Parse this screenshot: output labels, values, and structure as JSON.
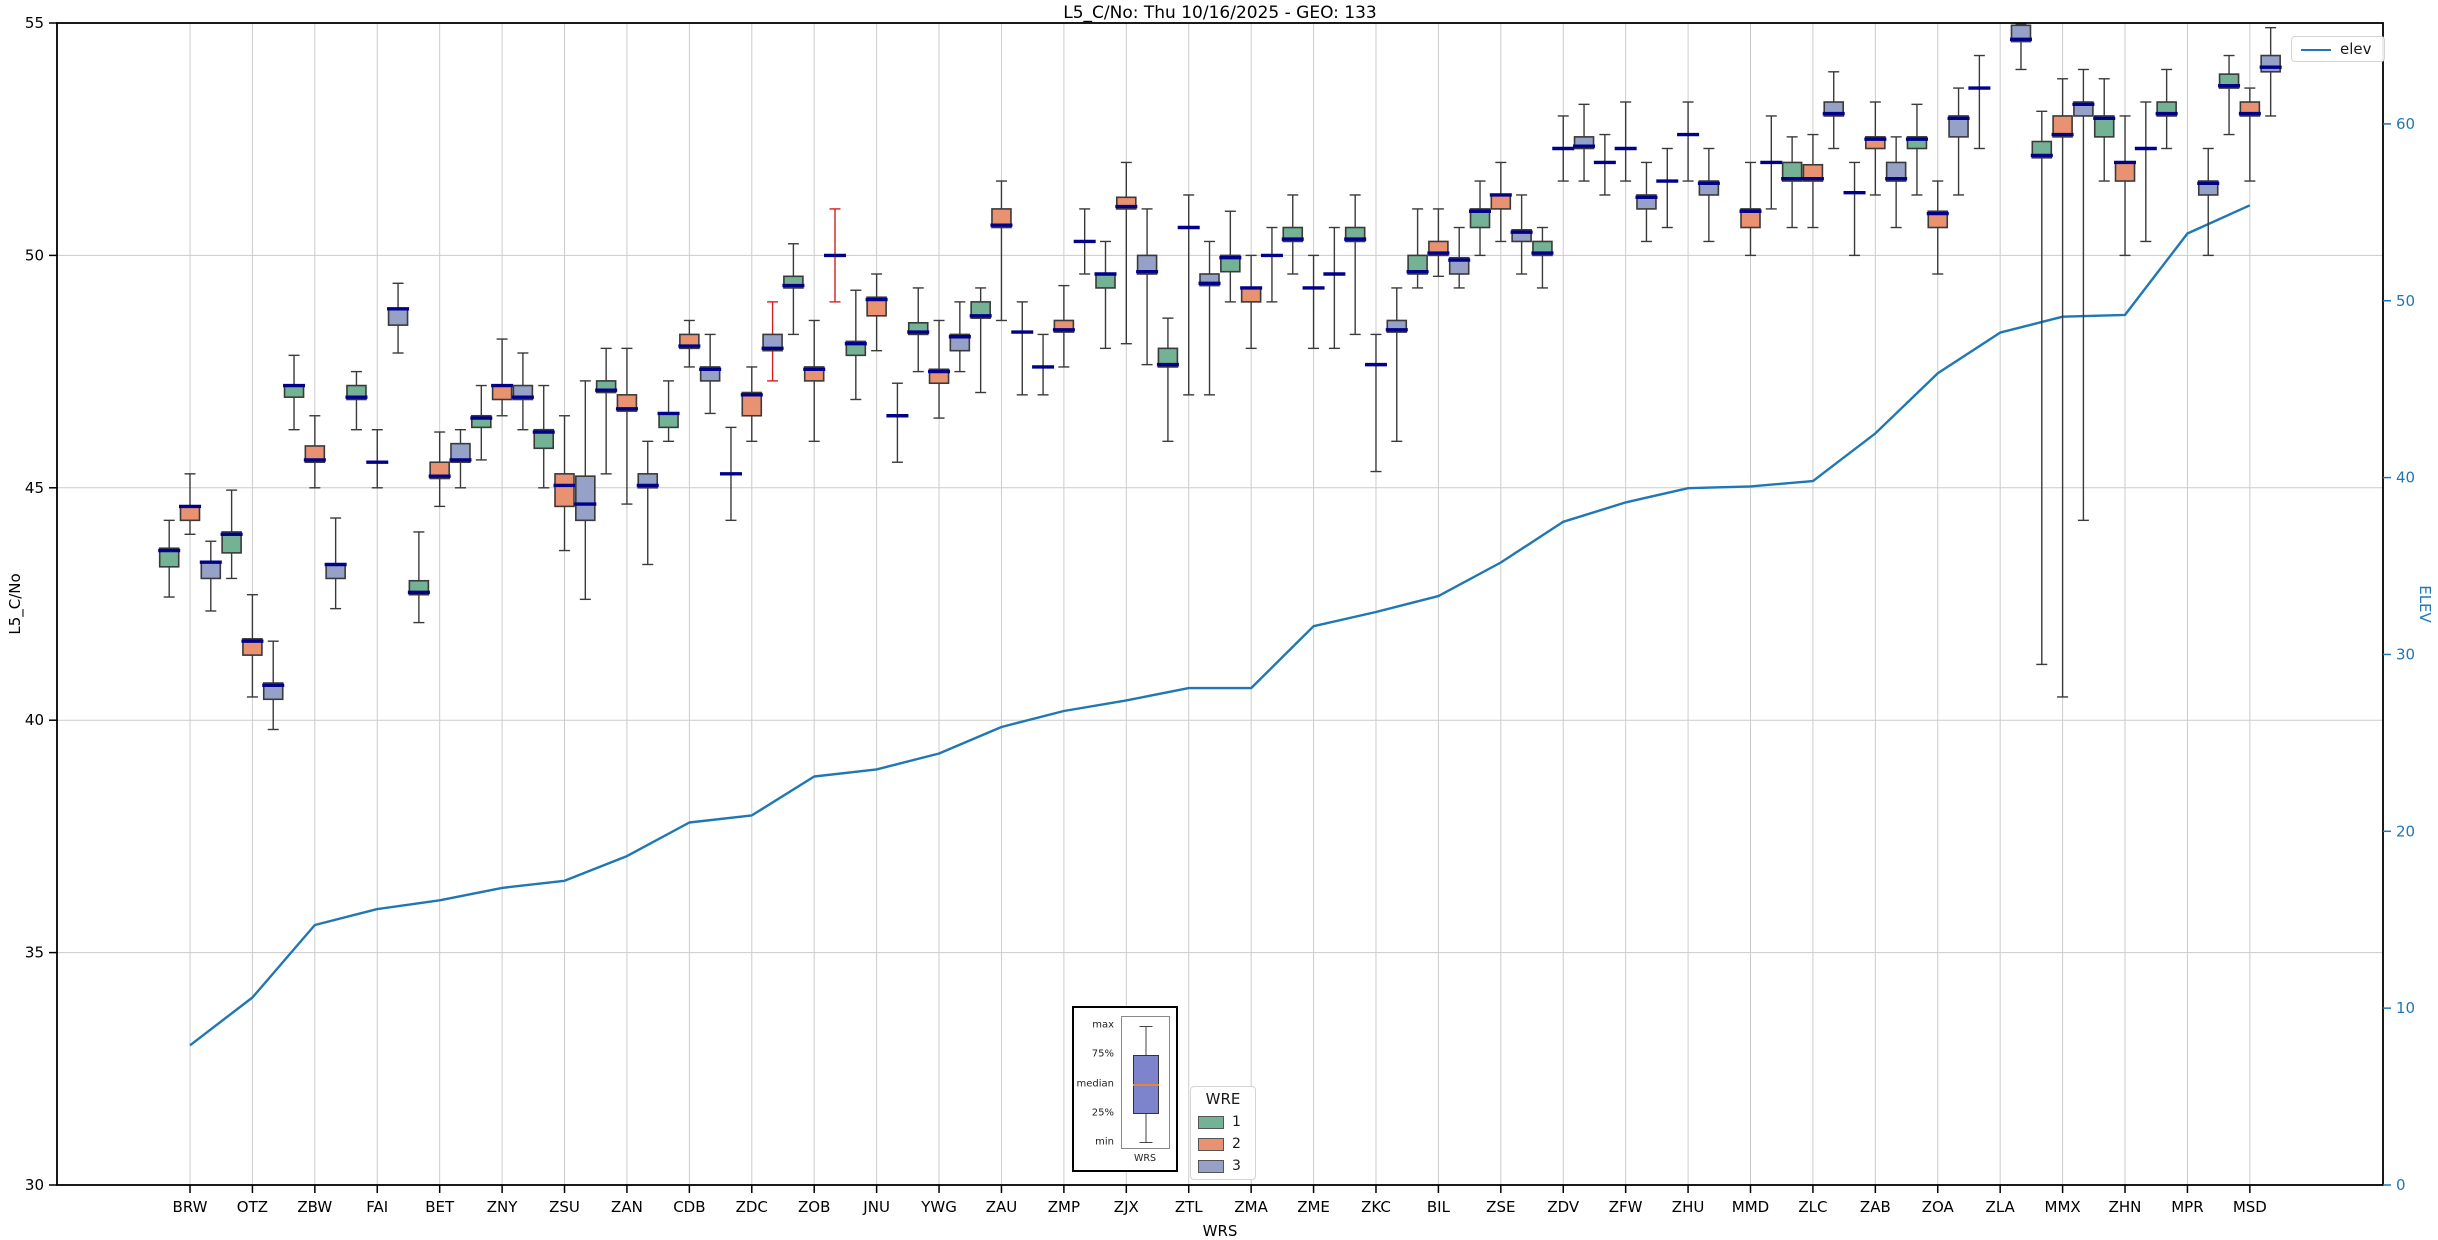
{
  "title": "L5_C/No: Thu 10/16/2025 - GEO: 133",
  "axes": {
    "left_label": "L5_C/No",
    "bottom_label": "WRS",
    "right_label": "ELEV",
    "left_ticks": [
      30,
      35,
      40,
      45,
      50,
      55
    ],
    "right_ticks": [
      0,
      10,
      20,
      30,
      40,
      50,
      60
    ],
    "left_range": [
      30,
      55
    ],
    "grid_values": [
      35,
      40,
      45,
      50
    ]
  },
  "legend_elev": {
    "label": "elev"
  },
  "legend_wre": {
    "title": "WRE",
    "entries": [
      {
        "label": "1",
        "color": "#73b294"
      },
      {
        "label": "2",
        "color": "#e99272"
      },
      {
        "label": "3",
        "color": "#95a1c7"
      }
    ]
  },
  "inset": {
    "rows": [
      {
        "label": "max"
      },
      {
        "label": "75%"
      },
      {
        "label": "median"
      },
      {
        "label": "25%"
      },
      {
        "label": "min"
      }
    ],
    "xlabel": "WRS"
  },
  "colors": {
    "box_fill": [
      "#73b294",
      "#e99272",
      "#95a1c7"
    ],
    "box_edge": "#3a3a3a",
    "median": "#00008b",
    "whisker": "#3a3a3a",
    "whisker_flagged": "#d62020",
    "elev_line": "#1f77b4",
    "grid": "#cccccc",
    "right_axis": "#1f77b4"
  },
  "chart_data": {
    "type": "box+line",
    "title": "L5_C/No: Thu 10/16/2025 - GEO: 133",
    "xlabel": "WRS",
    "ylabel_left": "L5_C/No",
    "ylabel_right": "ELEV",
    "ylim_left": [
      30,
      55
    ],
    "right_tick_range": [
      0,
      60
    ],
    "hue_title": "WRE",
    "hue_levels": [
      "1",
      "2",
      "3"
    ],
    "line_series_name": "elev",
    "categories": [
      "BRW",
      "OTZ",
      "ZBW",
      "FAI",
      "BET",
      "ZNY",
      "ZSU",
      "ZAN",
      "CDB",
      "ZDC",
      "ZOB",
      "JNU",
      "YWG",
      "ZAU",
      "ZMP",
      "ZJX",
      "ZTL",
      "ZMA",
      "ZME",
      "ZKC",
      "BIL",
      "ZSE",
      "ZDV",
      "ZFW",
      "ZHU",
      "MMD",
      "ZLC",
      "ZAB",
      "ZOA",
      "ZLA",
      "MMX",
      "ZHN",
      "MPR",
      "MSD"
    ],
    "stations": [
      {
        "name": "BRW",
        "elev": 7.9,
        "w1": {
          "lo": 42.65,
          "q1": 43.3,
          "med": 43.65,
          "q3": 43.7,
          "hi": 44.3
        },
        "w2": {
          "lo": 44.0,
          "q1": 44.3,
          "med": 44.6,
          "q3": 44.6,
          "hi": 45.3
        },
        "w3": {
          "lo": 42.35,
          "q1": 43.05,
          "med": 43.4,
          "q3": 43.4,
          "hi": 43.85
        }
      },
      {
        "name": "OTZ",
        "elev": 10.6,
        "w1": {
          "lo": 43.05,
          "q1": 43.6,
          "med": 44.0,
          "q3": 44.05,
          "hi": 44.95
        },
        "w2": {
          "lo": 40.5,
          "q1": 41.4,
          "med": 41.7,
          "q3": 41.75,
          "hi": 42.7
        },
        "w3": {
          "lo": 39.8,
          "q1": 40.45,
          "med": 40.75,
          "q3": 40.8,
          "hi": 41.7
        }
      },
      {
        "name": "ZBW",
        "elev": 14.7,
        "w1": {
          "lo": 46.25,
          "q1": 46.95,
          "med": 47.2,
          "q3": 47.2,
          "hi": 47.85
        },
        "w2": {
          "lo": 45.0,
          "q1": 45.55,
          "med": 45.6,
          "q3": 45.9,
          "hi": 46.55
        },
        "w3": {
          "lo": 42.4,
          "q1": 43.05,
          "med": 43.35,
          "q3": 43.35,
          "hi": 44.35
        }
      },
      {
        "name": "FAI",
        "elev": 15.6,
        "w1": {
          "lo": 46.25,
          "q1": 46.9,
          "med": 46.95,
          "q3": 47.2,
          "hi": 47.5
        },
        "w2": {
          "lo": 45.0,
          "q1": 45.55,
          "med": 45.55,
          "q3": 45.55,
          "hi": 46.25,
          "flat": true
        },
        "w3": {
          "lo": 47.9,
          "q1": 48.5,
          "med": 48.85,
          "q3": 48.85,
          "hi": 49.4
        }
      },
      {
        "name": "BET",
        "elev": 16.1,
        "w1": {
          "lo": 42.1,
          "q1": 42.7,
          "med": 42.75,
          "q3": 43.0,
          "hi": 44.05
        },
        "w2": {
          "lo": 44.6,
          "q1": 45.2,
          "med": 45.25,
          "q3": 45.55,
          "hi": 46.2
        },
        "w3": {
          "lo": 45.0,
          "q1": 45.55,
          "med": 45.6,
          "q3": 45.95,
          "hi": 46.25
        }
      },
      {
        "name": "ZNY",
        "elev": 16.8,
        "w1": {
          "lo": 45.6,
          "q1": 46.3,
          "med": 46.5,
          "q3": 46.55,
          "hi": 47.2
        },
        "w2": {
          "lo": 46.55,
          "q1": 46.9,
          "med": 47.2,
          "q3": 47.2,
          "hi": 48.2
        },
        "w3": {
          "lo": 46.25,
          "q1": 46.9,
          "med": 46.95,
          "q3": 47.2,
          "hi": 47.9
        }
      },
      {
        "name": "ZSU",
        "elev": 17.2,
        "w1": {
          "lo": 45.0,
          "q1": 45.85,
          "med": 46.2,
          "q3": 46.25,
          "hi": 47.2
        },
        "w2": {
          "lo": 43.65,
          "q1": 44.6,
          "med": 45.05,
          "q3": 45.3,
          "hi": 46.55
        },
        "w3": {
          "lo": 42.6,
          "q1": 44.3,
          "med": 44.65,
          "q3": 45.25,
          "hi": 47.3
        }
      },
      {
        "name": "ZAN",
        "elev": 18.6,
        "w1": {
          "lo": 45.3,
          "q1": 47.05,
          "med": 47.1,
          "q3": 47.3,
          "hi": 48.0
        },
        "w2": {
          "lo": 44.65,
          "q1": 46.65,
          "med": 46.7,
          "q3": 47.0,
          "hi": 48.0
        },
        "w3": {
          "lo": 43.35,
          "q1": 45.0,
          "med": 45.05,
          "q3": 45.3,
          "hi": 46.0
        }
      },
      {
        "name": "CDB",
        "elev": 20.5,
        "w1": {
          "lo": 46.0,
          "q1": 46.3,
          "med": 46.6,
          "q3": 46.6,
          "hi": 47.3
        },
        "w2": {
          "lo": 47.6,
          "q1": 48.0,
          "med": 48.05,
          "q3": 48.3,
          "hi": 48.6
        },
        "w3": {
          "lo": 46.6,
          "q1": 47.3,
          "med": 47.55,
          "q3": 47.6,
          "hi": 48.3
        }
      },
      {
        "name": "ZDC",
        "elev": 20.9,
        "w1": {
          "lo": 44.3,
          "q1": 45.3,
          "med": 45.3,
          "q3": 45.3,
          "hi": 46.3,
          "flat": true
        },
        "w2": {
          "lo": 46.0,
          "q1": 46.55,
          "med": 47.0,
          "q3": 47.05,
          "hi": 47.6
        },
        "w3": {
          "lo": 47.3,
          "q1": 47.95,
          "med": 48.0,
          "q3": 48.3,
          "hi": 49.0,
          "red": true
        }
      },
      {
        "name": "ZOB",
        "elev": 23.1,
        "w1": {
          "lo": 48.3,
          "q1": 49.3,
          "med": 49.35,
          "q3": 49.55,
          "hi": 50.25
        },
        "w2": {
          "lo": 46.0,
          "q1": 47.3,
          "med": 47.55,
          "q3": 47.6,
          "hi": 48.6
        },
        "w3": {
          "lo": 49.0,
          "q1": 50.0,
          "med": 50.0,
          "q3": 50.0,
          "hi": 51.0,
          "flat": true,
          "red": true
        }
      },
      {
        "name": "JNU",
        "elev": 23.5,
        "w1": {
          "lo": 46.9,
          "q1": 47.85,
          "med": 48.1,
          "q3": 48.15,
          "hi": 49.25
        },
        "w2": {
          "lo": 47.95,
          "q1": 48.7,
          "med": 49.05,
          "q3": 49.1,
          "hi": 49.6
        },
        "w3": {
          "lo": 45.55,
          "q1": 46.55,
          "med": 46.55,
          "q3": 46.55,
          "hi": 47.25,
          "flat": true
        }
      },
      {
        "name": "YWG",
        "elev": 24.4,
        "w1": {
          "lo": 47.5,
          "q1": 48.3,
          "med": 48.35,
          "q3": 48.55,
          "hi": 49.3
        },
        "w2": {
          "lo": 46.5,
          "q1": 47.25,
          "med": 47.5,
          "q3": 47.55,
          "hi": 48.6
        },
        "w3": {
          "lo": 47.5,
          "q1": 47.95,
          "med": 48.25,
          "q3": 48.3,
          "hi": 49.0
        }
      },
      {
        "name": "ZAU",
        "elev": 25.9,
        "w1": {
          "lo": 47.05,
          "q1": 48.65,
          "med": 48.7,
          "q3": 49.0,
          "hi": 49.3
        },
        "w2": {
          "lo": 48.6,
          "q1": 50.6,
          "med": 50.65,
          "q3": 51.0,
          "hi": 51.6
        },
        "w3": {
          "lo": 47.0,
          "q1": 48.35,
          "med": 48.35,
          "q3": 48.35,
          "hi": 49.0,
          "flat": true
        }
      },
      {
        "name": "ZMP",
        "elev": 26.8,
        "w1": {
          "lo": 47.0,
          "q1": 47.6,
          "med": 47.6,
          "q3": 47.6,
          "hi": 48.3,
          "flat": true
        },
        "w2": {
          "lo": 47.6,
          "q1": 48.35,
          "med": 48.4,
          "q3": 48.6,
          "hi": 49.35
        },
        "w3": {
          "lo": 49.6,
          "q1": 50.3,
          "med": 50.3,
          "q3": 50.3,
          "hi": 51.0,
          "flat": true
        }
      },
      {
        "name": "ZJX",
        "elev": 27.4,
        "w1": {
          "lo": 48.0,
          "q1": 49.3,
          "med": 49.6,
          "q3": 49.6,
          "hi": 50.3
        },
        "w2": {
          "lo": 48.1,
          "q1": 51.0,
          "med": 51.05,
          "q3": 51.25,
          "hi": 52.0
        },
        "w3": {
          "lo": 47.65,
          "q1": 49.6,
          "med": 49.65,
          "q3": 50.0,
          "hi": 51.0
        }
      },
      {
        "name": "ZTL",
        "elev": 28.1,
        "w1": {
          "lo": 46.0,
          "q1": 47.6,
          "med": 47.65,
          "q3": 48.0,
          "hi": 48.65
        },
        "w2": {
          "lo": 47.0,
          "q1": 50.6,
          "med": 50.6,
          "q3": 50.6,
          "hi": 51.3,
          "flat": true
        },
        "w3": {
          "lo": 47.0,
          "q1": 49.35,
          "med": 49.4,
          "q3": 49.6,
          "hi": 50.3
        }
      },
      {
        "name": "ZMA",
        "elev": 28.1,
        "w1": {
          "lo": 49.0,
          "q1": 49.65,
          "med": 49.95,
          "q3": 50.0,
          "hi": 50.95
        },
        "w2": {
          "lo": 48.0,
          "q1": 49.0,
          "med": 49.3,
          "q3": 49.3,
          "hi": 50.0
        },
        "w3": {
          "lo": 49.0,
          "q1": 50.0,
          "med": 50.0,
          "q3": 50.0,
          "hi": 50.6,
          "flat": true
        }
      },
      {
        "name": "ZME",
        "elev": 31.6,
        "w1": {
          "lo": 49.6,
          "q1": 50.3,
          "med": 50.35,
          "q3": 50.6,
          "hi": 51.3
        },
        "w2": {
          "lo": 48.0,
          "q1": 49.3,
          "med": 49.3,
          "q3": 49.3,
          "hi": 50.0,
          "flat": true
        },
        "w3": {
          "lo": 48.0,
          "q1": 49.6,
          "med": 49.6,
          "q3": 49.6,
          "hi": 50.6,
          "flat": true
        }
      },
      {
        "name": "ZKC",
        "elev": 32.4,
        "w1": {
          "lo": 48.3,
          "q1": 50.3,
          "med": 50.35,
          "q3": 50.6,
          "hi": 51.3
        },
        "w2": {
          "lo": 45.35,
          "q1": 47.65,
          "med": 47.65,
          "q3": 47.65,
          "hi": 48.3,
          "flat": true
        },
        "w3": {
          "lo": 46.0,
          "q1": 48.35,
          "med": 48.4,
          "q3": 48.6,
          "hi": 49.3
        }
      },
      {
        "name": "BIL",
        "elev": 33.3,
        "w1": {
          "lo": 49.3,
          "q1": 49.6,
          "med": 49.65,
          "q3": 50.0,
          "hi": 51.0
        },
        "w2": {
          "lo": 49.55,
          "q1": 50.0,
          "med": 50.05,
          "q3": 50.3,
          "hi": 51.0
        },
        "w3": {
          "lo": 49.3,
          "q1": 49.6,
          "med": 49.9,
          "q3": 49.95,
          "hi": 50.6
        }
      },
      {
        "name": "ZSE",
        "elev": 35.2,
        "w1": {
          "lo": 50.0,
          "q1": 50.6,
          "med": 50.95,
          "q3": 51.0,
          "hi": 51.6
        },
        "w2": {
          "lo": 50.3,
          "q1": 51.0,
          "med": 51.3,
          "q3": 51.3,
          "hi": 52.0
        },
        "w3": {
          "lo": 49.6,
          "q1": 50.3,
          "med": 50.5,
          "q3": 50.55,
          "hi": 51.3
        }
      },
      {
        "name": "ZDV",
        "elev": 37.5,
        "w1": {
          "lo": 49.3,
          "q1": 50.0,
          "med": 50.05,
          "q3": 50.3,
          "hi": 50.6
        },
        "w2": {
          "lo": 51.6,
          "q1": 52.3,
          "med": 52.3,
          "q3": 52.3,
          "hi": 53.0,
          "flat": true
        },
        "w3": {
          "lo": 51.6,
          "q1": 52.3,
          "med": 52.35,
          "q3": 52.55,
          "hi": 53.25
        }
      },
      {
        "name": "ZFW",
        "elev": 38.6,
        "w1": {
          "lo": 51.3,
          "q1": 52.0,
          "med": 52.0,
          "q3": 52.0,
          "hi": 52.6,
          "flat": true
        },
        "w2": {
          "lo": 51.6,
          "q1": 52.3,
          "med": 52.3,
          "q3": 52.3,
          "hi": 53.3,
          "flat": true
        },
        "w3": {
          "lo": 50.3,
          "q1": 51.0,
          "med": 51.25,
          "q3": 51.3,
          "hi": 52.0
        }
      },
      {
        "name": "ZHU",
        "elev": 39.4,
        "w1": {
          "lo": 50.6,
          "q1": 51.6,
          "med": 51.6,
          "q3": 51.6,
          "hi": 52.3,
          "flat": true
        },
        "w2": {
          "lo": 51.6,
          "q1": 52.6,
          "med": 52.6,
          "q3": 52.6,
          "hi": 53.3,
          "flat": true
        },
        "w3": {
          "lo": 50.3,
          "q1": 51.3,
          "med": 51.55,
          "q3": 51.6,
          "hi": 52.3
        }
      },
      {
        "name": "MMD",
        "elev": 39.5,
        "w1": null,
        "w2": {
          "lo": 50.0,
          "q1": 50.6,
          "med": 50.95,
          "q3": 51.0,
          "hi": 52.0
        },
        "w3": {
          "lo": 51.0,
          "q1": 52.0,
          "med": 52.0,
          "q3": 52.0,
          "hi": 53.0,
          "flat": true
        }
      },
      {
        "name": "ZLC",
        "elev": 39.8,
        "w1": {
          "lo": 50.6,
          "q1": 51.6,
          "med": 51.65,
          "q3": 52.0,
          "hi": 52.55
        },
        "w2": {
          "lo": 50.6,
          "q1": 51.6,
          "med": 51.65,
          "q3": 51.95,
          "hi": 52.6
        },
        "w3": {
          "lo": 52.3,
          "q1": 53.0,
          "med": 53.05,
          "q3": 53.3,
          "hi": 53.95
        }
      },
      {
        "name": "ZAB",
        "elev": 42.5,
        "w1": {
          "lo": 50.0,
          "q1": 51.35,
          "med": 51.35,
          "q3": 51.35,
          "hi": 52.0,
          "flat": true
        },
        "w2": {
          "lo": 51.3,
          "q1": 52.3,
          "med": 52.5,
          "q3": 52.55,
          "hi": 53.3
        },
        "w3": {
          "lo": 50.6,
          "q1": 51.6,
          "med": 51.65,
          "q3": 52.0,
          "hi": 52.55
        }
      },
      {
        "name": "ZOA",
        "elev": 45.9,
        "w1": {
          "lo": 51.3,
          "q1": 52.3,
          "med": 52.5,
          "q3": 52.55,
          "hi": 53.25
        },
        "w2": {
          "lo": 49.6,
          "q1": 50.6,
          "med": 50.9,
          "q3": 50.95,
          "hi": 51.6
        },
        "w3": {
          "lo": 51.3,
          "q1": 52.55,
          "med": 52.95,
          "q3": 53.0,
          "hi": 53.6
        }
      },
      {
        "name": "ZLA",
        "elev": 48.2,
        "w1": {
          "lo": 52.3,
          "q1": 53.6,
          "med": 53.6,
          "q3": 53.6,
          "hi": 54.3,
          "flat": true
        },
        "w2": null,
        "w3": {
          "lo": 54.0,
          "q1": 54.6,
          "med": 54.65,
          "q3": 54.95,
          "hi": 54.98
        }
      },
      {
        "name": "MMX",
        "elev": 49.1,
        "w1": {
          "lo": 41.2,
          "q1": 52.1,
          "med": 52.15,
          "q3": 52.45,
          "hi": 53.1
        },
        "w2": {
          "lo": 40.5,
          "q1": 52.55,
          "med": 52.6,
          "q3": 53.0,
          "hi": 53.8
        },
        "w3": {
          "lo": 44.3,
          "q1": 53.0,
          "med": 53.25,
          "q3": 53.3,
          "hi": 54.0
        }
      },
      {
        "name": "ZHN",
        "elev": 49.2,
        "w1": {
          "lo": 51.6,
          "q1": 52.55,
          "med": 52.95,
          "q3": 53.0,
          "hi": 53.8
        },
        "w2": {
          "lo": 50.0,
          "q1": 51.6,
          "med": 52.0,
          "q3": 52.0,
          "hi": 53.0
        },
        "w3": {
          "lo": 50.3,
          "q1": 52.3,
          "med": 52.3,
          "q3": 52.3,
          "hi": 53.3,
          "flat": true
        }
      },
      {
        "name": "MPR",
        "elev": 53.8,
        "w1": {
          "lo": 52.3,
          "q1": 53.0,
          "med": 53.05,
          "q3": 53.3,
          "hi": 54.0
        },
        "w2": null,
        "w3": {
          "lo": 50.0,
          "q1": 51.3,
          "med": 51.55,
          "q3": 51.6,
          "hi": 52.3
        }
      },
      {
        "name": "MSD",
        "elev": 55.4,
        "w1": {
          "lo": 52.6,
          "q1": 53.6,
          "med": 53.65,
          "q3": 53.9,
          "hi": 54.3
        },
        "w2": {
          "lo": 51.6,
          "q1": 53.0,
          "med": 53.05,
          "q3": 53.3,
          "hi": 53.6
        },
        "w3": {
          "lo": 53.0,
          "q1": 53.95,
          "med": 54.05,
          "q3": 54.3,
          "hi": 54.9
        }
      }
    ]
  }
}
